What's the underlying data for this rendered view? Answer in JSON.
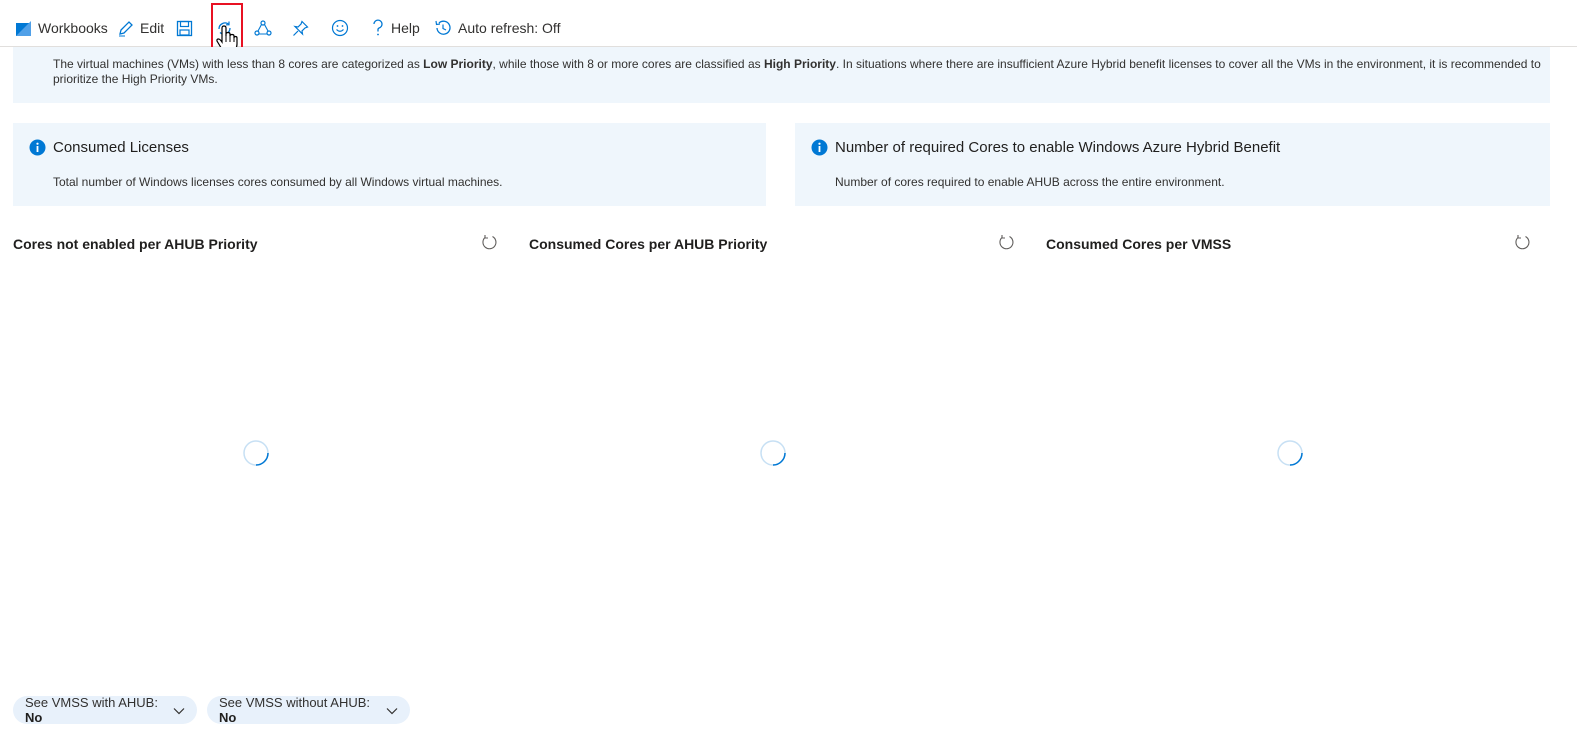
{
  "toolbar": {
    "workbooks_label": "Workbooks",
    "edit_label": "Edit",
    "help_label": "Help",
    "auto_refresh_label": "Auto refresh: Off",
    "icons": [
      "workbooks-icon",
      "edit-icon",
      "save-icon",
      "refresh-icon",
      "share-icon",
      "pin-icon",
      "feedback-icon",
      "help-icon",
      "history-icon"
    ]
  },
  "banner": {
    "text_1": "The virtual machines (VMs) with less than 8 cores are categorized as ",
    "bold_1": "Low Priority",
    "text_2": ", while those with 8 or more cores are classified as ",
    "bold_2": "High Priority",
    "text_3": ". In situations where there are insufficient Azure Hybrid benefit licenses to cover all the VMs in the environment, it is recommended to prioritize the High Priority VMs."
  },
  "cards": [
    {
      "title": "Consumed Licenses",
      "description": "Total number of Windows licenses cores consumed by all Windows virtual machines."
    },
    {
      "title": "Number of required Cores to enable Windows Azure Hybrid Benefit",
      "description": "Number of cores required to enable AHUB across the entire environment."
    }
  ],
  "panels": [
    {
      "title": "Cores not enabled per AHUB Priority"
    },
    {
      "title": "Consumed Cores per AHUB Priority"
    },
    {
      "title": "Consumed Cores per VMSS"
    }
  ],
  "filters": [
    {
      "label": "See VMSS with AHUB: ",
      "value": "No"
    },
    {
      "label": "See VMSS without AHUB: ",
      "value": "No"
    }
  ],
  "colors": {
    "accent": "#0078d4",
    "banner_bg": "#eff6fc",
    "highlight": "#e81123",
    "pill_bg": "#e8f1fb"
  }
}
